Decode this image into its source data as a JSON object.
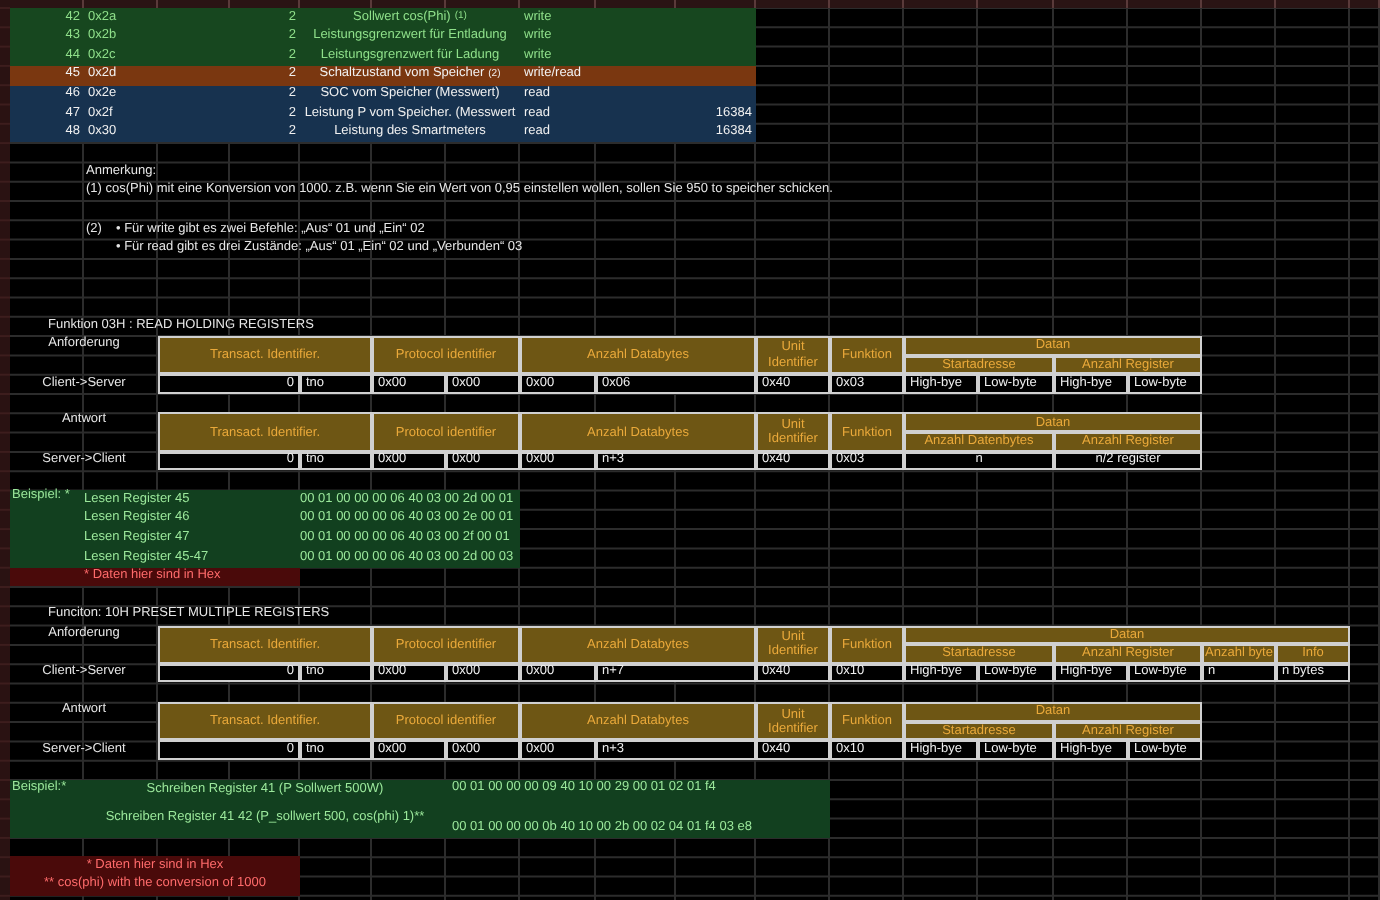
{
  "registers": [
    {
      "number": "42",
      "address": "0x2a",
      "length": "2",
      "name": "Sollwert cos(Phi)",
      "note_ref": "(1)",
      "access": "write",
      "kind": "write"
    },
    {
      "number": "43",
      "address": "0x2b",
      "length": "2",
      "name": "Leistungsgrenzwert für Entladung",
      "access": "write",
      "kind": "write"
    },
    {
      "number": "44",
      "address": "0x2c",
      "length": "2",
      "name": "Leistungsgrenzwert für Ladung",
      "access": "write",
      "kind": "write"
    },
    {
      "number": "45",
      "address": "0x2d",
      "length": "2",
      "name": "Schaltzustand vom Speicher",
      "note_ref": "(2)",
      "access": "write/read",
      "kind": "write_read"
    },
    {
      "number": "46",
      "address": "0x2e",
      "length": "2",
      "name": "SOC vom Speicher (Messwert)",
      "access": "read",
      "kind": "read"
    },
    {
      "number": "47",
      "address": "0x2f",
      "length": "2",
      "name": "Leistung P vom Speicher. (Messwert",
      "access": "read",
      "value": "16384",
      "kind": "read"
    },
    {
      "number": "48",
      "address": "0x30",
      "length": "2",
      "name": "Leistung des Smartmeters",
      "access": "read",
      "value": "16384",
      "kind": "read"
    }
  ],
  "remarks": {
    "title": "Anmerkung:",
    "note_1": "(1)  cos(Phi) mit eine Konversion von 1000. z.B. wenn Sie ein Wert von 0,95 einstellen  wollen, sollen Sie 950 to speicher schicken.",
    "note_2": {
      "marker": "(2)",
      "bullets": [
        "• Für write gibt es zwei Befehle: „Aus“ 01 und „Ein“ 02",
        "• Für read gibt es drei Zustände: „Aus“ 01 „Ein“ 02 und „Verbunden“ 03"
      ]
    }
  },
  "sections": [
    {
      "title": "Funktion 03H : READ HOLDING REGISTERS",
      "request": {
        "label": "Anforderung",
        "direction": "Client->Server",
        "columns": [
          "Transact. Identifier.",
          "Protocol identifier",
          "Anzahl Databytes",
          "Unit Identifier",
          "Funktion"
        ],
        "data_title": "Datan",
        "data_columns": [
          "Startadresse",
          "Anzahl Register"
        ],
        "values": [
          "0",
          "tno",
          "0x00",
          "0x00",
          "0x00",
          "0x06",
          "0x40",
          "0x03"
        ],
        "data_values": [
          "High-bye",
          "Low-byte",
          "High-bye",
          "Low-byte"
        ]
      },
      "response": {
        "label": "Antwort",
        "direction": "Server->Client",
        "columns": [
          "Transact. Identifier.",
          "Protocol identifier",
          "Anzahl Databytes",
          "Unit Identifier",
          "Funktion"
        ],
        "data_title": "Datan",
        "data_columns": [
          "Anzahl Datenbytes",
          "Anzahl Register"
        ],
        "values": [
          "0",
          "tno",
          "0x00",
          "0x00",
          "0x00",
          "n+3",
          "0x40",
          "0x03"
        ],
        "data_values": [
          "n",
          "n/2 register"
        ]
      },
      "example": {
        "label": "Beispiel: *",
        "kind": "read",
        "rows": [
          {
            "name": "Lesen Register 45",
            "hex": "00 01 00 00 00 06 40 03 00 2d 00 01"
          },
          {
            "name": "Lesen Register 46",
            "hex": "00 01 00 00 00 06 40 03 00 2e 00 01"
          },
          {
            "name": "Lesen Register 47",
            "hex": "00 01 00 00 00 06 40 03 00 2f 00 01"
          },
          {
            "name": "Lesen Register 45-47",
            "hex": "00 01 00 00 00 06 40 03 00 2d 00 03"
          }
        ],
        "footnotes": [
          "* Daten hier sind in Hex"
        ]
      }
    },
    {
      "title": "Funciton: 10H PRESET MULTIPLE REGISTERS",
      "request": {
        "label": "Anforderung",
        "direction": "Client->Server",
        "columns": [
          "Transact. Identifier.",
          "Protocol identifier",
          "Anzahl Databytes",
          "Unit Identifier",
          "Funktion"
        ],
        "data_title": "Datan",
        "data_columns": [
          "Startadresse",
          "Anzahl Register",
          "Anzahl byte",
          "Info"
        ],
        "values": [
          "0",
          "tno",
          "0x00",
          "0x00",
          "0x00",
          "n+7",
          "0x40",
          "0x10"
        ],
        "data_values": [
          "High-bye",
          "Low-byte",
          "High-bye",
          "Low-byte",
          "n",
          "n bytes"
        ]
      },
      "response": {
        "label": "Antwort",
        "direction": "Server->Client",
        "columns": [
          "Transact. Identifier.",
          "Protocol identifier",
          "Anzahl Databytes",
          "Unit Identifier",
          "Funktion"
        ],
        "data_title": "Datan",
        "data_columns": [
          "Startadresse",
          "Anzahl Register"
        ],
        "values": [
          "0",
          "tno",
          "0x00",
          "0x00",
          "0x00",
          "n+3",
          "0x40",
          "0x10"
        ],
        "data_values": [
          "High-bye",
          "Low-byte",
          "High-bye",
          "Low-byte"
        ]
      },
      "example": {
        "label": "Beispiel:*",
        "kind": "write",
        "rows": [
          {
            "name": "Schreiben Register 41 (P Sollwert 500W)",
            "hex": "00 01 00 00 00 09 40 10 00 29 00 01 02 01 f4"
          },
          {
            "name": "Schreiben Register 41 42 (P_sollwert 500, cos(phi) 1)**",
            "hex": "00 01 00 00 00 0b 40 10 00 2b 00 02  04 01 f4 03 e8"
          }
        ],
        "footnotes": [
          "* Daten hier sind in Hex",
          "** cos(phi) with the conversion of 1000"
        ]
      }
    }
  ]
}
